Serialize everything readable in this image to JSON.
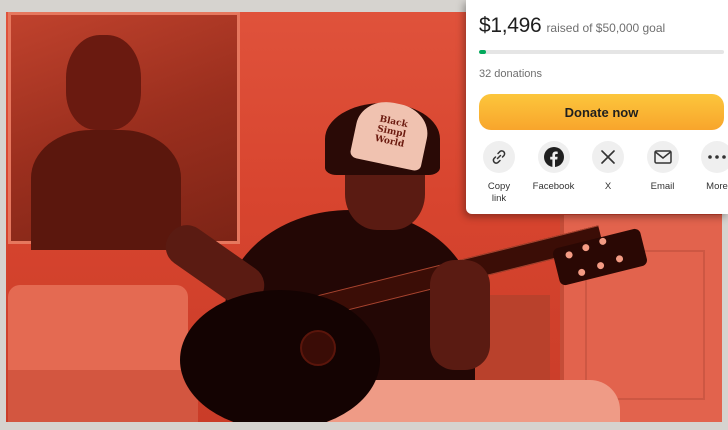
{
  "card": {
    "amount_raised": "$1,496",
    "goal_text": "raised of $50,000 goal",
    "progress_fraction": 0.03,
    "donations_text": "32 donations",
    "donate_label": "Donate now",
    "accent_color": "#02a95c",
    "button_color": "#f8a52c"
  },
  "share": {
    "items": [
      {
        "icon": "link-icon",
        "label": "Copy link"
      },
      {
        "icon": "facebook-icon",
        "label": "Facebook"
      },
      {
        "icon": "x-icon",
        "label": "X"
      },
      {
        "icon": "email-icon",
        "label": "Email"
      },
      {
        "icon": "more-icon",
        "label": "More"
      }
    ]
  }
}
